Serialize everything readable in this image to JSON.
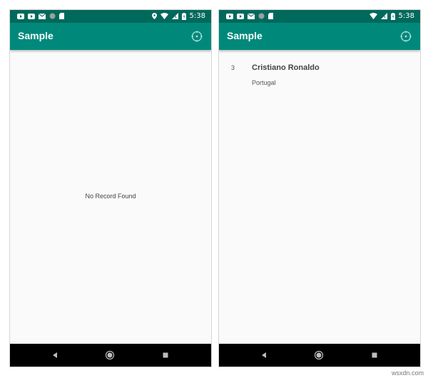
{
  "watermark": "wsxdn.com",
  "screens": [
    {
      "status_bar": {
        "time": "5:38"
      },
      "app_bar": {
        "title": "Sample",
        "action_icon": "compass-icon"
      },
      "content": {
        "empty_message": "No Record Found"
      }
    },
    {
      "status_bar": {
        "time": "5:38"
      },
      "app_bar": {
        "title": "Sample",
        "action_icon": "compass-icon"
      },
      "content": {
        "records": [
          {
            "id": "3",
            "name": "Cristiano Ronaldo",
            "country": "Portugal"
          }
        ]
      }
    }
  ],
  "colors": {
    "status_bar": "#00695c",
    "app_bar": "#00897b",
    "background": "#fafafa",
    "nav_bar": "#000000"
  }
}
